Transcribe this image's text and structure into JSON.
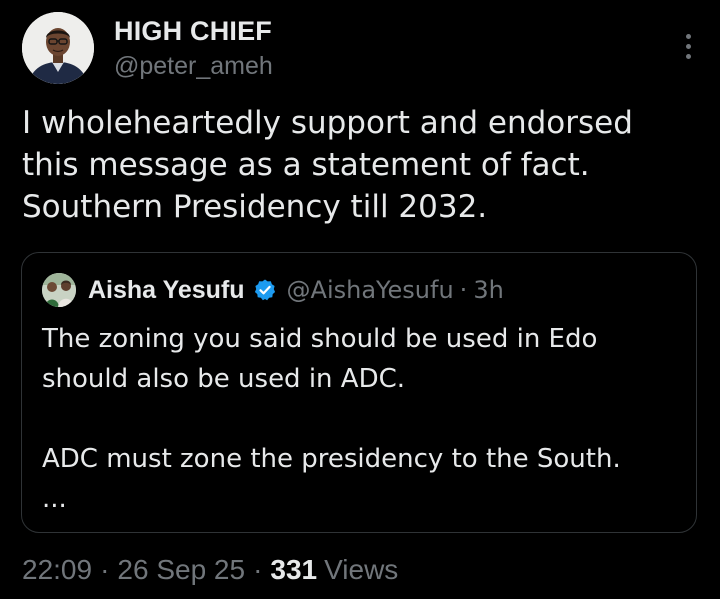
{
  "author": {
    "display_name": "HIGH CHIEF",
    "handle": "@peter_ameh",
    "avatar_icon": "user-avatar-photo"
  },
  "tweet": {
    "text": "I wholeheartedly support and endorsed\nthis message as a statement of fact.\nSouthern Presidency till 2032."
  },
  "quoted_tweet": {
    "display_name": "Aisha Yesufu",
    "verified_icon": "verified-badge-icon",
    "verified_color": "#1d9bf0",
    "handle": "@AishaYesufu",
    "separator": "·",
    "time": "3h",
    "text": "The zoning you said should be used in Edo\nshould also be used in ADC.\n\nADC must zone the presidency to the South.\n..."
  },
  "meta": {
    "time": "22:09",
    "separator": "·",
    "date": "26 Sep 25",
    "views_count": "331",
    "views_label": "Views"
  },
  "colors": {
    "background": "#000000",
    "primary_text": "#e7e9ea",
    "secondary_text": "#71767b",
    "border": "#2f3336"
  }
}
